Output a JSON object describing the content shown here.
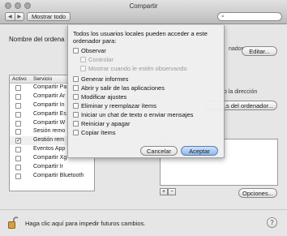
{
  "window": {
    "title": "Compartir",
    "show_all_label": "Mostrar todo",
    "back_glyph": "◀",
    "forward_glyph": "▶",
    "search_icon": "magnifier-icon",
    "search_glyph": "⌕"
  },
  "computer": {
    "name_label": "Nombre del ordena",
    "address_fragment": "nador",
    "edit_label": "Editar..."
  },
  "services": {
    "headers": [
      "Activo",
      "Servicio"
    ],
    "rows": [
      {
        "checked": false,
        "name": "Compartir Pa"
      },
      {
        "checked": false,
        "name": "Compartir Ar"
      },
      {
        "checked": false,
        "name": "Compartir In"
      },
      {
        "checked": false,
        "name": "Compartir Es"
      },
      {
        "checked": false,
        "name": "Compartir W"
      },
      {
        "checked": false,
        "name": "Sesión remo"
      },
      {
        "checked": true,
        "name": "Gestión rem",
        "selected": true
      },
      {
        "checked": false,
        "name": "Eventos App"
      },
      {
        "checked": false,
        "name": "Compartir Xg"
      },
      {
        "checked": false,
        "name": "Compartir Ir"
      },
      {
        "checked": false,
        "name": "Compartir Bluetooth"
      }
    ]
  },
  "right_panel": {
    "direction_text": "o la dirección",
    "computer_settings_label": "...s del ordenador...",
    "add_glyph": "+",
    "remove_glyph": "−",
    "options_label": "Opciones..."
  },
  "footer": {
    "lock_text": "Haga clic aquí para impedir futuros cambios.",
    "help_glyph": "?"
  },
  "sheet": {
    "prompt": "Todos los usuarios locales pueden acceder a este ordenador para:",
    "options": [
      {
        "label": "Observar",
        "checked": false,
        "enabled": true,
        "indent": false
      },
      {
        "label": "Controlar",
        "checked": false,
        "enabled": false,
        "indent": true
      },
      {
        "label": "Mostrar cuando le estén observando",
        "checked": false,
        "enabled": false,
        "indent": true
      },
      {
        "label": "Generar informes",
        "checked": false,
        "enabled": true,
        "indent": false
      },
      {
        "label": "Abrir y salir de las aplicaciones",
        "checked": false,
        "enabled": true,
        "indent": false
      },
      {
        "label": "Modificar ajustes",
        "checked": false,
        "enabled": true,
        "indent": false
      },
      {
        "label": "Eliminar y reemplazar ítems",
        "checked": false,
        "enabled": true,
        "indent": false
      },
      {
        "label": "Iniciar un chat de texto o enviar mensajes",
        "checked": false,
        "enabled": true,
        "indent": false
      },
      {
        "label": "Reiniciar y apagar",
        "checked": false,
        "enabled": true,
        "indent": false
      },
      {
        "label": "Copiar ítems",
        "checked": false,
        "enabled": true,
        "indent": false
      }
    ],
    "cancel_label": "Cancelar",
    "accept_label": "Aceptar"
  }
}
